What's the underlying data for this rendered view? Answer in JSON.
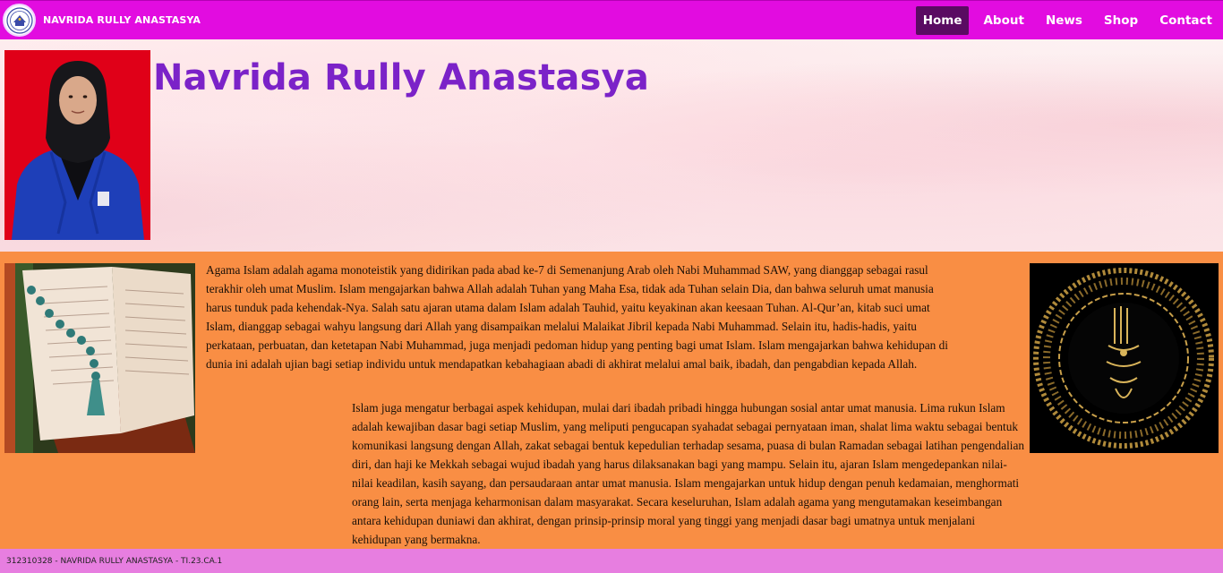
{
  "brand": {
    "name": "NAVRIDA RULLY ANASTASYA"
  },
  "nav": {
    "items": [
      "Home",
      "About",
      "News",
      "Shop",
      "Contact"
    ],
    "active": "Home"
  },
  "hero": {
    "title": "Navrida Rully Anastasya"
  },
  "content": {
    "paragraph1": "Agama Islam adalah agama monoteistik yang didirikan pada abad ke-7 di Semenanjung Arab oleh Nabi Muhammad SAW, yang dianggap sebagai rasul terakhir oleh umat Muslim. Islam mengajarkan bahwa Allah adalah Tuhan yang Maha Esa, tidak ada Tuhan selain Dia, dan bahwa seluruh umat manusia harus tunduk pada kehendak-Nya. Salah satu ajaran utama dalam Islam adalah Tauhid, yaitu keyakinan akan keesaan Tuhan. Al-Qur’an, kitab suci umat Islam, dianggap sebagai wahyu langsung dari Allah yang disampaikan melalui Malaikat Jibril kepada Nabi Muhammad. Selain itu, hadis-hadis, yaitu perkataan, perbuatan, dan ketetapan Nabi Muhammad, juga menjadi pedoman hidup yang penting bagi umat Islam. Islam mengajarkan bahwa kehidupan di dunia ini adalah ujian bagi setiap individu untuk mendapatkan kebahagiaan abadi di akhirat melalui amal baik, ibadah, dan pengabdian kepada Allah.",
    "paragraph2": "Islam juga mengatur berbagai aspek kehidupan, mulai dari ibadah pribadi hingga hubungan sosial antar umat manusia. Lima rukun Islam adalah kewajiban dasar bagi setiap Muslim, yang meliputi pengucapan syahadat sebagai pernyataan iman, shalat lima waktu sebagai bentuk komunikasi langsung dengan Allah, zakat sebagai bentuk kepedulian terhadap sesama, puasa di bulan Ramadan sebagai latihan pengendalian diri, dan haji ke Mekkah sebagai wujud ibadah yang harus dilaksanakan bagi yang mampu. Selain itu, ajaran Islam mengedepankan nilai-nilai keadilan, kasih sayang, dan persaudaraan antar umat manusia. Islam mengajarkan untuk hidup dengan penuh kedamaian, menghormati orang lain, serta menjaga keharmonisan dalam masyarakat. Secara keseluruhan, Islam adalah agama yang mengutamakan keseimbangan antara kehidupan duniawi dan akhirat, dengan prinsip-prinsip moral yang tinggi yang menjadi dasar bagi umatnya untuk menjalani kehidupan yang bermakna."
  },
  "footer": {
    "text": "312310328 - NAVRIDA RULLY ANASTASYA - TI.23.CA.1"
  },
  "colors": {
    "navbar": "#e20ce0",
    "nav_active": "#5a0b62",
    "title": "#7b22c8",
    "content_bg": "#f98e44",
    "footer_bg": "#e77ee0"
  }
}
